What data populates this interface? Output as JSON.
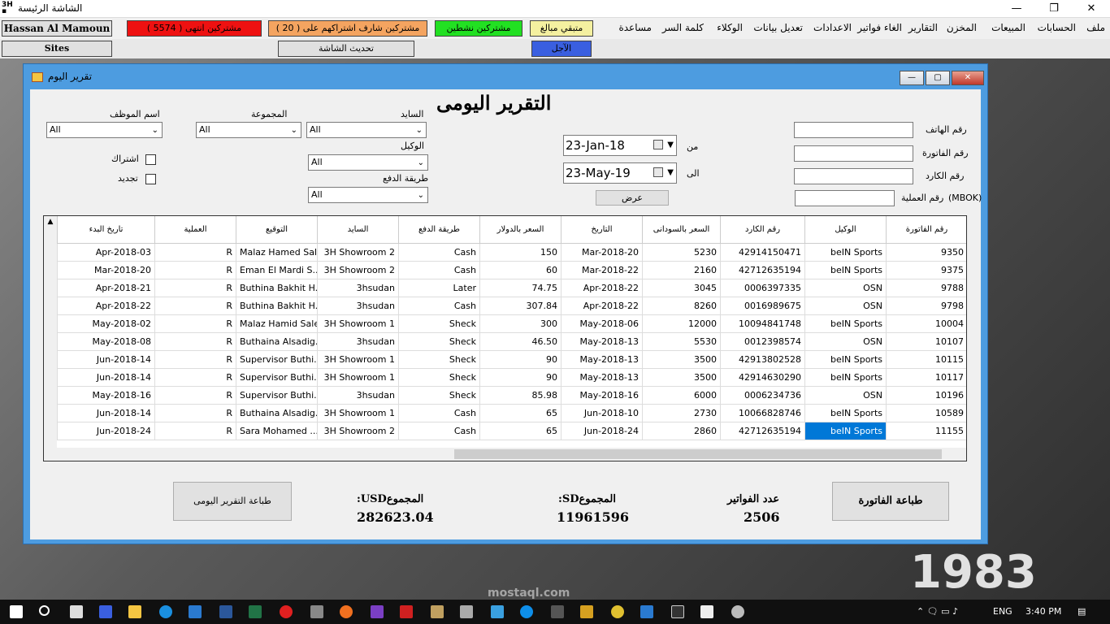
{
  "window": {
    "title": "الشاشة الرئيسة",
    "minimize": "—",
    "restore": "❐",
    "close": "✕"
  },
  "menu": [
    "ملف",
    "الحسابات",
    "المبيعات",
    "المخزن",
    "التقارير",
    "الغاء فواتير",
    "الاعدادات",
    "تعديل بيانات",
    "الوكلاء",
    "كلمة السر",
    "مساعدة"
  ],
  "toolbar": {
    "user": "Hassan Al Mamoun",
    "expired": "مشتركين انتهى ( 5574 )",
    "near_expiry": "مشتركين شارف اشتراكهم على ( 20 )",
    "active": "مشتركين نشطين",
    "remaining": "متبقي مبالغ",
    "sites": "Sites",
    "refresh": "تحديث الشاشة",
    "deferred": "الآجل"
  },
  "dialog": {
    "title": "تقرير اليوم",
    "heading": "التقرير اليومى",
    "labels": {
      "phone": "رقم الهاتف",
      "invoice": "رقم الفاتورة",
      "card": "رقم الكارد",
      "op": "رقم العملية",
      "mbok": "(MBOK)",
      "from": "من",
      "to": "الى",
      "employee": "اسم الموظف",
      "group": "المجموعة",
      "site": "السايد",
      "agent": "الوكيل",
      "payment": "طريقة الدفع",
      "subscription": "اشتراك",
      "renewal": "تجديد"
    },
    "date_from": "23-Jan-18",
    "date_to": "23-May-19",
    "show": "عرض",
    "combos": {
      "employee": "All",
      "group": "All",
      "site": "All",
      "agent": "All",
      "payment": "All"
    },
    "columns": [
      "رقم الفاتورة",
      "الوكيل",
      "رقم الكارد",
      "السعر بالسودانى",
      "التاريخ",
      "السعر بالدولار",
      "طريقة الدفع",
      "السايد",
      "التوقيع",
      "العملية",
      "تاريخ البدء"
    ],
    "rows": [
      [
        "9350",
        "beIN Sports",
        "42914150471",
        "5230",
        "Mar-2018-20",
        "150",
        "Cash",
        "3H Showroom 2",
        "Malaz Hamed Sal...",
        "R",
        "Apr-2018-03"
      ],
      [
        "9375",
        "beIN Sports",
        "42712635194",
        "2160",
        "Mar-2018-22",
        "60",
        "Cash",
        "3H Showroom 2",
        "Eman El Mardi S...",
        "R",
        "Mar-2018-20"
      ],
      [
        "9788",
        "OSN",
        "0006397335",
        "3045",
        "Apr-2018-22",
        "74.75",
        "Later",
        "3hsudan",
        "Buthina Bakhit H...",
        "R",
        "Apr-2018-21"
      ],
      [
        "9798",
        "OSN",
        "0016989675",
        "8260",
        "Apr-2018-22",
        "307.84",
        "Cash",
        "3hsudan",
        "Buthina Bakhit H...",
        "R",
        "Apr-2018-22"
      ],
      [
        "10004",
        "beIN Sports",
        "10094841748",
        "12000",
        "May-2018-06",
        "300",
        "Sheck",
        "3H Showroom 1",
        "Malaz Hamid Salem",
        "R",
        "May-2018-02"
      ],
      [
        "10107",
        "OSN",
        "0012398574",
        "5530",
        "May-2018-13",
        "46.50",
        "Sheck",
        "3hsudan",
        "Buthaina Alsadig...",
        "R",
        "May-2018-08"
      ],
      [
        "10115",
        "beIN Sports",
        "42913802528",
        "3500",
        "May-2018-13",
        "90",
        "Sheck",
        "3H Showroom 1",
        "Supervisor Buthi...",
        "R",
        "Jun-2018-14"
      ],
      [
        "10117",
        "beIN Sports",
        "42914630290",
        "3500",
        "May-2018-13",
        "90",
        "Sheck",
        "3H Showroom 1",
        "Supervisor Buthi...",
        "R",
        "Jun-2018-14"
      ],
      [
        "10196",
        "OSN",
        "0006234736",
        "6000",
        "May-2018-16",
        "85.98",
        "Sheck",
        "3hsudan",
        "Supervisor Buthi...",
        "R",
        "May-2018-16"
      ],
      [
        "10589",
        "beIN Sports",
        "10066828746",
        "2730",
        "Jun-2018-10",
        "65",
        "Cash",
        "3H Showroom 1",
        "Buthaina Alsadig...",
        "R",
        "Jun-2018-14"
      ],
      [
        "11155",
        "beIN Sports",
        "42712635194",
        "2860",
        "Jun-2018-24",
        "65",
        "Cash",
        "3H Showroom 2",
        "Sara Mohamed ...",
        "R",
        "Jun-2018-24"
      ]
    ],
    "summary": {
      "print_daily": "طباعة التقرير اليومى",
      "usd_label": "المجموعUSD:",
      "usd_value": "282623.04",
      "sd_label": "المجموعSD:",
      "sd_value": "11961596",
      "count_label": "عدد الفواتير",
      "count_value": "2506",
      "print_invoice": "طباعة الفاتورة"
    }
  },
  "taskbar": {
    "lang": "ENG",
    "time": "3:40 PM"
  },
  "watermark": {
    "number": "1983",
    "site": "mostaql.com"
  }
}
